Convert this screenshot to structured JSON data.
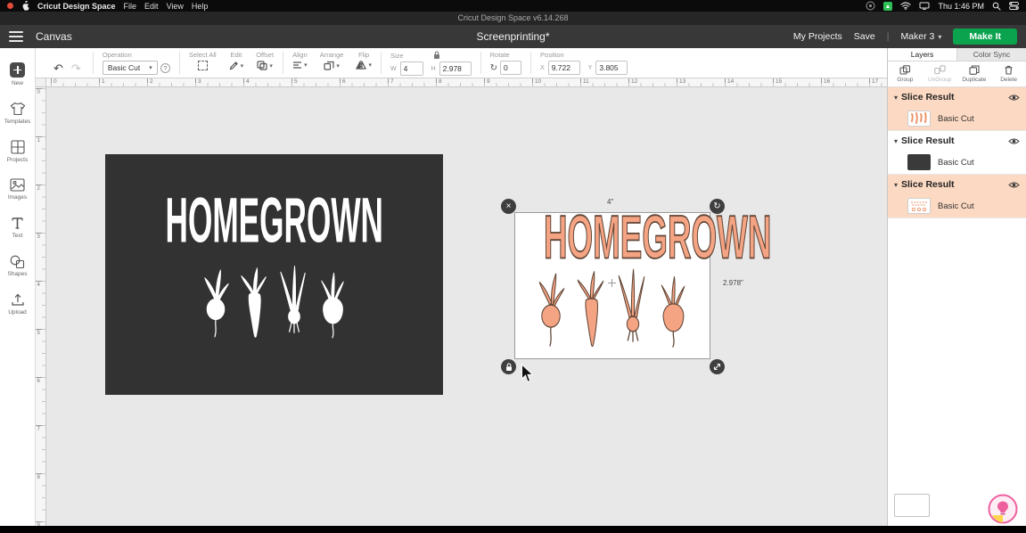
{
  "menubar": {
    "app_name": "Cricut Design Space",
    "menus": [
      "File",
      "Edit",
      "View",
      "Help"
    ],
    "clock": "Thu 1:46 PM"
  },
  "titlebar": {
    "title": "Cricut Design Space  v6.14.268"
  },
  "header": {
    "canvas_label": "Canvas",
    "doc_title": "Screenprinting*",
    "my_projects": "My Projects",
    "save": "Save",
    "divider": "|",
    "machine": "Maker 3",
    "make_it": "Make It"
  },
  "toolbar": {
    "operation": {
      "label": "Operation",
      "value": "Basic Cut",
      "help": "?"
    },
    "select_all_label": "Select All",
    "edit_label": "Edit",
    "offset_label": "Offset",
    "align_label": "Align",
    "arrange_label": "Arrange",
    "flip_label": "Flip",
    "size": {
      "label": "Size",
      "w_label": "W",
      "w": "4",
      "h_label": "H",
      "h": "2.978"
    },
    "rotate": {
      "label": "Rotate",
      "value": "0"
    },
    "position": {
      "label": "Position",
      "x_label": "X",
      "x": "9.722",
      "y_label": "Y",
      "y": "3.805"
    }
  },
  "sidebar": {
    "items": [
      {
        "label": "New",
        "icon": "plus-badge"
      },
      {
        "label": "Templates",
        "icon": "t-shirt"
      },
      {
        "label": "Projects",
        "icon": "grid"
      },
      {
        "label": "Images",
        "icon": "photo"
      },
      {
        "label": "Text",
        "icon": "letter-T"
      },
      {
        "label": "Shapes",
        "icon": "circle-square"
      },
      {
        "label": "Upload",
        "icon": "upload-arrow"
      }
    ]
  },
  "rulers": {
    "horizontal": [
      "0",
      "1",
      "2",
      "3",
      "4",
      "5",
      "6",
      "7",
      "8",
      "9",
      "10",
      "11",
      "12",
      "13",
      "14",
      "15",
      "16",
      "17"
    ],
    "vertical": [
      "0",
      "1",
      "2",
      "3",
      "4",
      "5",
      "6",
      "7",
      "8",
      "9"
    ]
  },
  "canvas": {
    "artwork_word": "HOMEGROWN",
    "selection": {
      "width": "4\"",
      "height": "2.978\""
    }
  },
  "layers_panel": {
    "tabs": [
      {
        "label": "Layers"
      },
      {
        "label": "Color Sync"
      }
    ],
    "actions": [
      {
        "label": "Group"
      },
      {
        "label": "UnGroup"
      },
      {
        "label": "Duplicate"
      },
      {
        "label": "Delete"
      }
    ],
    "groups": [
      {
        "title": "Slice Result",
        "child": "Basic Cut",
        "highlighted": true,
        "thumb": "orange-solid"
      },
      {
        "title": "Slice Result",
        "child": "Basic Cut",
        "highlighted": false,
        "thumb": "dark"
      },
      {
        "title": "Slice Result",
        "child": "Basic Cut",
        "highlighted": true,
        "thumb": "orange-outline"
      }
    ]
  },
  "icons": {
    "undo": "↶",
    "redo": "↷",
    "chevron_down": "▾",
    "close": "×",
    "rotate": "↻"
  },
  "colors": {
    "accent_green": "#0ba34e",
    "selection_peach": "#fcd9c2",
    "artwork_orange": "#f4a383",
    "artwork_outline": "#5f4536",
    "dark_mat": "#323232"
  }
}
